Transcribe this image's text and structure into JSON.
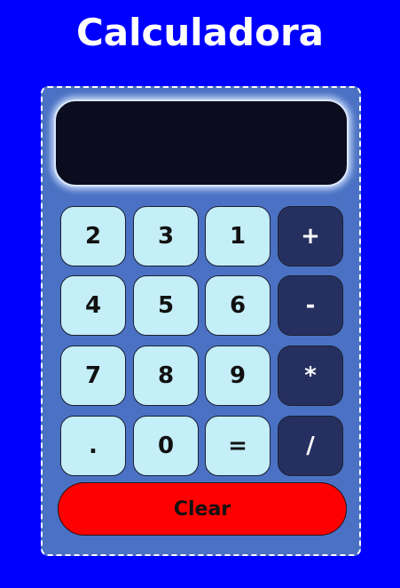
{
  "app": {
    "title": "Calculadora"
  },
  "display": {
    "value": ""
  },
  "keys": {
    "row1": [
      "2",
      "3",
      "1",
      "+"
    ],
    "row2": [
      "4",
      "5",
      "6",
      "-"
    ],
    "row3": [
      "7",
      "8",
      "9",
      "*"
    ],
    "row4": [
      ".",
      "0",
      "=",
      "/"
    ]
  },
  "clear_label": "Clear",
  "colors": {
    "page_background": "#0000ff",
    "calculator_body": "#4a71c4",
    "display_background": "#0b0d1f",
    "digit_key": "#c4eef8",
    "operator_key": "#263060",
    "clear_button": "#ff0000"
  }
}
